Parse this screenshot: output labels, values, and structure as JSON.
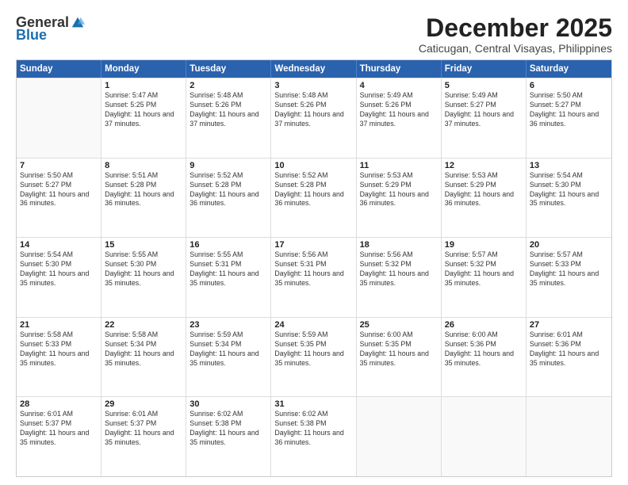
{
  "logo": {
    "general": "General",
    "blue": "Blue"
  },
  "title": "December 2025",
  "location": "Caticugan, Central Visayas, Philippines",
  "header_days": [
    "Sunday",
    "Monday",
    "Tuesday",
    "Wednesday",
    "Thursday",
    "Friday",
    "Saturday"
  ],
  "rows": [
    [
      {
        "day": "",
        "empty": true
      },
      {
        "day": "1",
        "sunrise": "5:47 AM",
        "sunset": "5:25 PM",
        "daylight": "11 hours and 37 minutes."
      },
      {
        "day": "2",
        "sunrise": "5:48 AM",
        "sunset": "5:26 PM",
        "daylight": "11 hours and 37 minutes."
      },
      {
        "day": "3",
        "sunrise": "5:48 AM",
        "sunset": "5:26 PM",
        "daylight": "11 hours and 37 minutes."
      },
      {
        "day": "4",
        "sunrise": "5:49 AM",
        "sunset": "5:26 PM",
        "daylight": "11 hours and 37 minutes."
      },
      {
        "day": "5",
        "sunrise": "5:49 AM",
        "sunset": "5:27 PM",
        "daylight": "11 hours and 37 minutes."
      },
      {
        "day": "6",
        "sunrise": "5:50 AM",
        "sunset": "5:27 PM",
        "daylight": "11 hours and 36 minutes."
      }
    ],
    [
      {
        "day": "7",
        "sunrise": "5:50 AM",
        "sunset": "5:27 PM",
        "daylight": "11 hours and 36 minutes."
      },
      {
        "day": "8",
        "sunrise": "5:51 AM",
        "sunset": "5:28 PM",
        "daylight": "11 hours and 36 minutes."
      },
      {
        "day": "9",
        "sunrise": "5:52 AM",
        "sunset": "5:28 PM",
        "daylight": "11 hours and 36 minutes."
      },
      {
        "day": "10",
        "sunrise": "5:52 AM",
        "sunset": "5:28 PM",
        "daylight": "11 hours and 36 minutes."
      },
      {
        "day": "11",
        "sunrise": "5:53 AM",
        "sunset": "5:29 PM",
        "daylight": "11 hours and 36 minutes."
      },
      {
        "day": "12",
        "sunrise": "5:53 AM",
        "sunset": "5:29 PM",
        "daylight": "11 hours and 36 minutes."
      },
      {
        "day": "13",
        "sunrise": "5:54 AM",
        "sunset": "5:30 PM",
        "daylight": "11 hours and 35 minutes."
      }
    ],
    [
      {
        "day": "14",
        "sunrise": "5:54 AM",
        "sunset": "5:30 PM",
        "daylight": "11 hours and 35 minutes."
      },
      {
        "day": "15",
        "sunrise": "5:55 AM",
        "sunset": "5:30 PM",
        "daylight": "11 hours and 35 minutes."
      },
      {
        "day": "16",
        "sunrise": "5:55 AM",
        "sunset": "5:31 PM",
        "daylight": "11 hours and 35 minutes."
      },
      {
        "day": "17",
        "sunrise": "5:56 AM",
        "sunset": "5:31 PM",
        "daylight": "11 hours and 35 minutes."
      },
      {
        "day": "18",
        "sunrise": "5:56 AM",
        "sunset": "5:32 PM",
        "daylight": "11 hours and 35 minutes."
      },
      {
        "day": "19",
        "sunrise": "5:57 AM",
        "sunset": "5:32 PM",
        "daylight": "11 hours and 35 minutes."
      },
      {
        "day": "20",
        "sunrise": "5:57 AM",
        "sunset": "5:33 PM",
        "daylight": "11 hours and 35 minutes."
      }
    ],
    [
      {
        "day": "21",
        "sunrise": "5:58 AM",
        "sunset": "5:33 PM",
        "daylight": "11 hours and 35 minutes."
      },
      {
        "day": "22",
        "sunrise": "5:58 AM",
        "sunset": "5:34 PM",
        "daylight": "11 hours and 35 minutes."
      },
      {
        "day": "23",
        "sunrise": "5:59 AM",
        "sunset": "5:34 PM",
        "daylight": "11 hours and 35 minutes."
      },
      {
        "day": "24",
        "sunrise": "5:59 AM",
        "sunset": "5:35 PM",
        "daylight": "11 hours and 35 minutes."
      },
      {
        "day": "25",
        "sunrise": "6:00 AM",
        "sunset": "5:35 PM",
        "daylight": "11 hours and 35 minutes."
      },
      {
        "day": "26",
        "sunrise": "6:00 AM",
        "sunset": "5:36 PM",
        "daylight": "11 hours and 35 minutes."
      },
      {
        "day": "27",
        "sunrise": "6:01 AM",
        "sunset": "5:36 PM",
        "daylight": "11 hours and 35 minutes."
      }
    ],
    [
      {
        "day": "28",
        "sunrise": "6:01 AM",
        "sunset": "5:37 PM",
        "daylight": "11 hours and 35 minutes."
      },
      {
        "day": "29",
        "sunrise": "6:01 AM",
        "sunset": "5:37 PM",
        "daylight": "11 hours and 35 minutes."
      },
      {
        "day": "30",
        "sunrise": "6:02 AM",
        "sunset": "5:38 PM",
        "daylight": "11 hours and 35 minutes."
      },
      {
        "day": "31",
        "sunrise": "6:02 AM",
        "sunset": "5:38 PM",
        "daylight": "11 hours and 36 minutes."
      },
      {
        "day": "",
        "empty": true
      },
      {
        "day": "",
        "empty": true
      },
      {
        "day": "",
        "empty": true
      }
    ]
  ]
}
